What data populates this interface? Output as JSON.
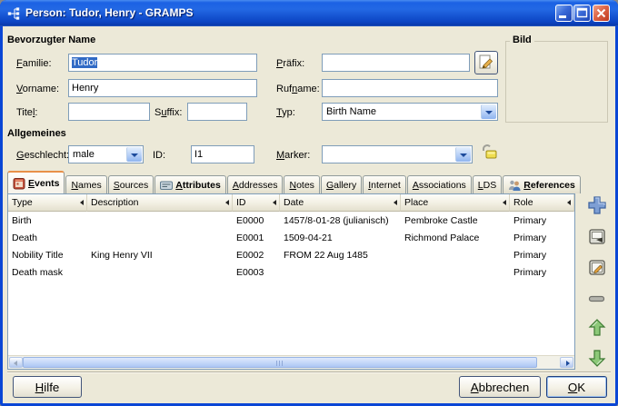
{
  "window": {
    "title": "Person: Tudor, Henry - GRAMPS"
  },
  "colors": {
    "titlebar_blue": "#1B61E4",
    "dialog_bg": "#ECE9D8",
    "selection_blue": "#316AC5",
    "field_border": "#7F9DB9",
    "active_tab_stripe": "#E89048"
  },
  "name_section": {
    "heading": "Bevorzugter Name",
    "familie": {
      "label": "Familie:",
      "u": 0,
      "value": "Tudor"
    },
    "praefix": {
      "label": "Präfix:",
      "u": 0,
      "value": ""
    },
    "vorname": {
      "label": "Vorname:",
      "u": 0,
      "value": "Henry"
    },
    "rufname": {
      "label": "Rufname:",
      "u": 3,
      "value": ""
    },
    "titel": {
      "label": "Titel:",
      "u": 4,
      "value": ""
    },
    "suffix": {
      "label": "Suffix:",
      "u": 1,
      "value": ""
    },
    "typ": {
      "label": "Typ:",
      "u": 0,
      "value": "Birth Name"
    },
    "bild": {
      "label": "Bild"
    }
  },
  "general_section": {
    "heading": "Allgemeines",
    "geschlecht": {
      "label": "Geschlecht:",
      "u": 0,
      "value": "male"
    },
    "id": {
      "label": "ID:",
      "value": "I1"
    },
    "marker": {
      "label": "Marker:",
      "u": 0,
      "value": ""
    }
  },
  "tabs": [
    {
      "label": "Events",
      "u": 0,
      "active": true,
      "bold": true,
      "icon": "event-icon"
    },
    {
      "label": "Names",
      "u": 0
    },
    {
      "label": "Sources",
      "u": 0
    },
    {
      "label": "Attributes",
      "u": 0,
      "bold": true,
      "icon": "attribute-icon"
    },
    {
      "label": "Addresses",
      "u": 0
    },
    {
      "label": "Notes",
      "u": 0
    },
    {
      "label": "Gallery",
      "u": 0
    },
    {
      "label": "Internet",
      "u": 0
    },
    {
      "label": "Associations",
      "u": 0
    },
    {
      "label": "LDS",
      "u": 0
    },
    {
      "label": "References",
      "u": 0,
      "bold": true,
      "icon": "references-icon"
    }
  ],
  "events_table": {
    "columns": [
      "Type",
      "Description",
      "ID",
      "Date",
      "Place",
      "Role"
    ],
    "rows": [
      [
        "Birth",
        "",
        "E0000",
        "1457/8-01-28 (julianisch)",
        "Pembroke Castle",
        "Primary"
      ],
      [
        "Death",
        "",
        "E0001",
        "1509-04-21",
        "Richmond Palace",
        "Primary"
      ],
      [
        "Nobility Title",
        "King Henry VII",
        "E0002",
        "FROM 22 Aug 1485",
        "",
        "Primary"
      ],
      [
        "Death mask",
        "",
        "E0003",
        "",
        "",
        "Primary"
      ]
    ]
  },
  "icons": {
    "side_buttons": [
      "add-icon",
      "share-icon",
      "edit-icon",
      "remove-icon",
      "move-up-icon",
      "move-down-icon"
    ],
    "privacy": "unlock-icon",
    "name_edit": "pencil-icon"
  },
  "footer": {
    "hilfe": {
      "label": "Hilfe",
      "u": 0
    },
    "abbrechen": {
      "label": "Abbrechen",
      "u": 0
    },
    "ok": {
      "label": "OK",
      "u": 0
    }
  }
}
